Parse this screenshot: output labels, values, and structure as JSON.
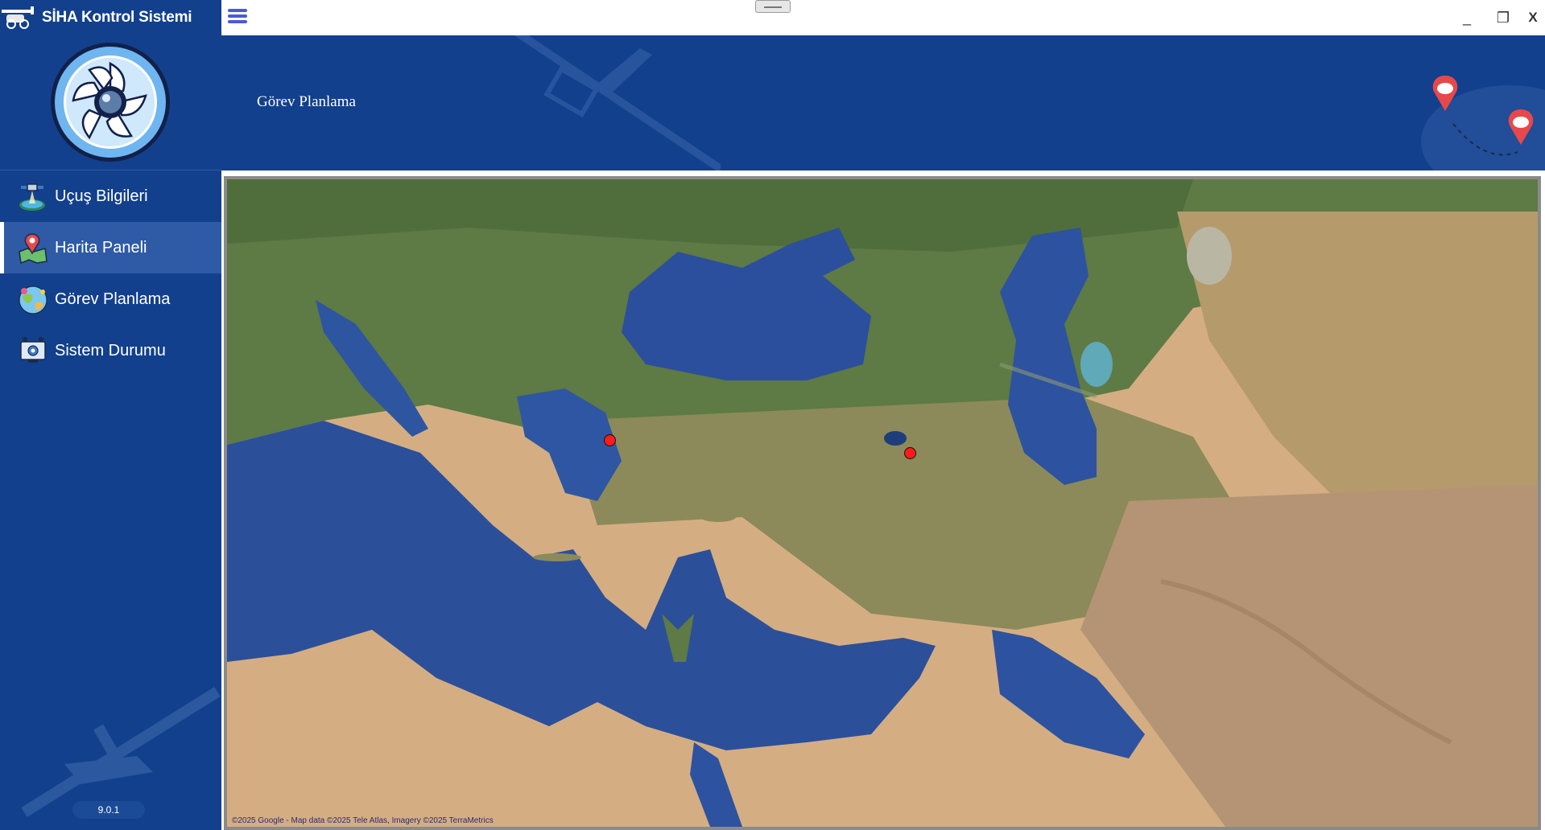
{
  "app": {
    "title": "SİHA Kontrol Sistemi",
    "version": "9.0.1"
  },
  "sidebar": {
    "items": [
      {
        "label": "Uçuş Bilgileri",
        "icon": "satellite-icon",
        "active": false
      },
      {
        "label": "Harita Paneli",
        "icon": "map-pin-icon",
        "active": true
      },
      {
        "label": "Görev Planlama",
        "icon": "globe-icon",
        "active": false
      },
      {
        "label": "Sistem Durumu",
        "icon": "monitor-gear-icon",
        "active": false
      }
    ]
  },
  "window": {
    "minimize": "_",
    "maximize": "❐",
    "close": "X"
  },
  "header": {
    "title": "Görev Planlama"
  },
  "map": {
    "attribution": "©2025 Google - Map data ©2025 Tele Atlas, Imagery ©2025 TerraMetrics",
    "marker_color": "#ff1b1b",
    "markers": [
      {
        "name": "marker-west-anatolia"
      },
      {
        "name": "marker-east-anatolia"
      }
    ]
  },
  "colors": {
    "primary": "#12408c",
    "active_item": "#2e5aa6",
    "hamburger": "#4a5ad6"
  }
}
